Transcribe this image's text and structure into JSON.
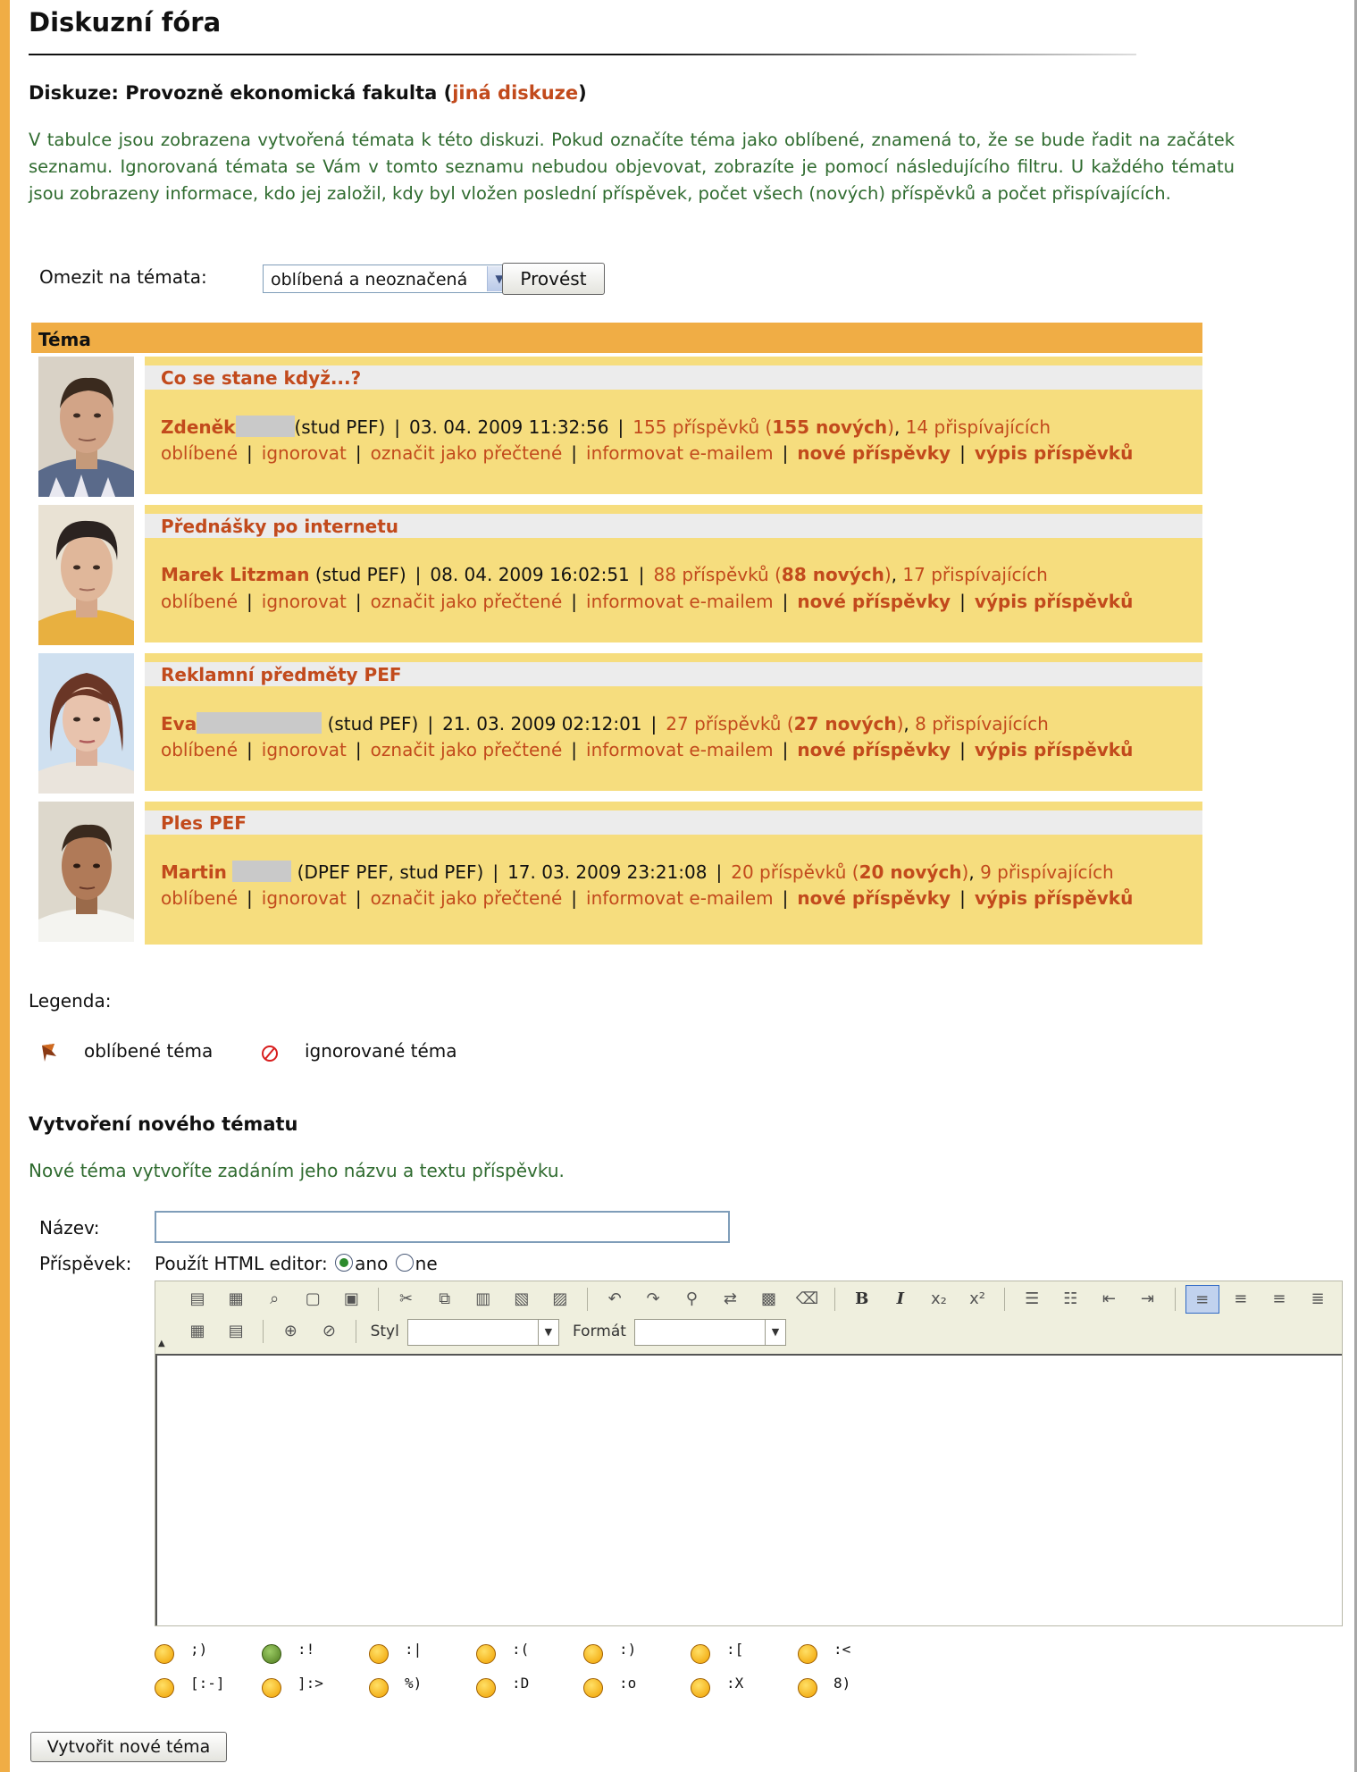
{
  "page": {
    "title": "Diskuzní fóra",
    "discussion_prefix": "Diskuze: Provozně ekonomická fakulta (",
    "discussion_link": "jiná diskuze",
    "discussion_suffix": ")",
    "intro": "V tabulce jsou zobrazena vytvořená témata k této diskuzi. Pokud označíte téma jako oblíbené, znamená to, že se bude řadit na začátek seznamu. Ignorovaná témata se Vám v tomto seznamu nebudou objevovat, zobrazíte je pomocí následujícího filtru. U každého tématu jsou zobrazeny informace, kdo jej založil, kdy byl vložen poslední příspěvek, počet všech (nových) příspěvků a počet přispívajících."
  },
  "filter": {
    "label": "Omezit na témata:",
    "selected": "oblíbená a neoznačená",
    "button": "Provést"
  },
  "table": {
    "header": "Téma",
    "actions": {
      "favorite": "oblíbené",
      "ignore": "ignorovat",
      "mark_read": "označit jako přečtené",
      "notify": "informovat e-mailem",
      "new_posts": "nové příspěvky",
      "list_posts": "výpis příspěvků"
    },
    "topics": [
      {
        "name": "Co se stane když...?",
        "author": "Zdeněk",
        "role": "(stud PEF)",
        "date": "03. 04. 2009 11:32:56",
        "posts": "155 příspěvků",
        "new_count": "155 nových",
        "contributors": "14 přispívajících"
      },
      {
        "name": "Přednášky po internetu",
        "author": "Marek Litzman",
        "role": "(stud PEF)",
        "date": "08. 04. 2009 16:02:51",
        "posts": "88 příspěvků",
        "new_count": "88 nových",
        "contributors": "17 přispívajících"
      },
      {
        "name": "Reklamní předměty PEF",
        "author": "Eva",
        "role": "(stud PEF)",
        "date": "21. 03. 2009 02:12:01",
        "posts": "27 příspěvků",
        "new_count": "27 nových",
        "contributors": "8 přispívajících"
      },
      {
        "name": "Ples PEF",
        "author": "Martin",
        "role": "(DPEF PEF, stud PEF)",
        "date": "17. 03. 2009 23:21:08",
        "posts": "20 příspěvků",
        "new_count": "20 nových",
        "contributors": "9 přispívajících"
      }
    ]
  },
  "legend": {
    "title": "Legenda:",
    "favorite": "oblíbené téma",
    "ignored": "ignorované téma"
  },
  "new_topic": {
    "title": "Vytvoření nového tématu",
    "description": "Nové téma vytvoříte zadáním jeho názvu a textu příspěvku.",
    "name_label": "Název:",
    "post_label": "Příspěvek:",
    "html_editor_label": "Použít HTML editor:",
    "yes": "ano",
    "no": "ne",
    "style_label": "Styl",
    "format_label": "Formát",
    "submit": "Vytvořit nové téma"
  },
  "smileys": [
    ";)",
    ":!",
    ":|",
    ":(",
    ":)",
    ":[",
    ":<",
    "[:-]",
    "]:>",
    "%)",
    ":D",
    ":o",
    ":X",
    "8)"
  ],
  "colors": {
    "accent": "#f0ad45",
    "panel": "#f6dd7e",
    "link": "#c24a1c",
    "green_text": "#2f6b2f"
  }
}
